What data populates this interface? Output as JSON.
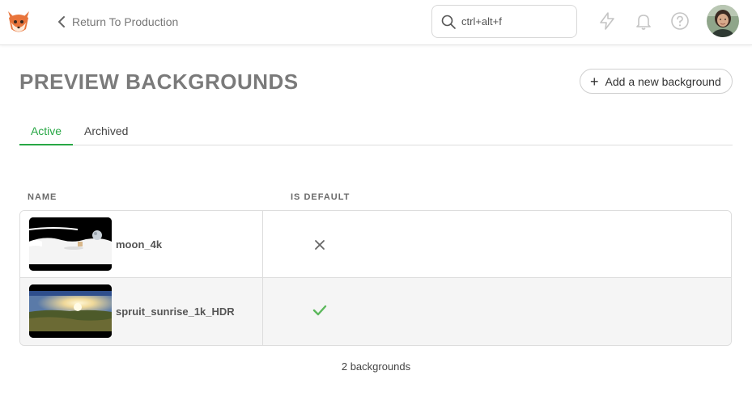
{
  "topbar": {
    "back_label": "Return To Production",
    "search_placeholder": "ctrl+alt+f"
  },
  "page": {
    "title": "PREVIEW BACKGROUNDS",
    "add_button_label": "Add a new background"
  },
  "tabs": [
    {
      "label": "Active",
      "active": true
    },
    {
      "label": "Archived",
      "active": false
    }
  ],
  "table": {
    "headers": {
      "name": "NAME",
      "is_default": "IS DEFAULT"
    },
    "rows": [
      {
        "name": "moon_4k",
        "is_default": false
      },
      {
        "name": "spruit_sunrise_1k_HDR",
        "is_default": true
      }
    ]
  },
  "footer": {
    "count_label": "2 backgrounds"
  },
  "colors": {
    "accent": "#28a745",
    "title": "#7a7a7a"
  }
}
